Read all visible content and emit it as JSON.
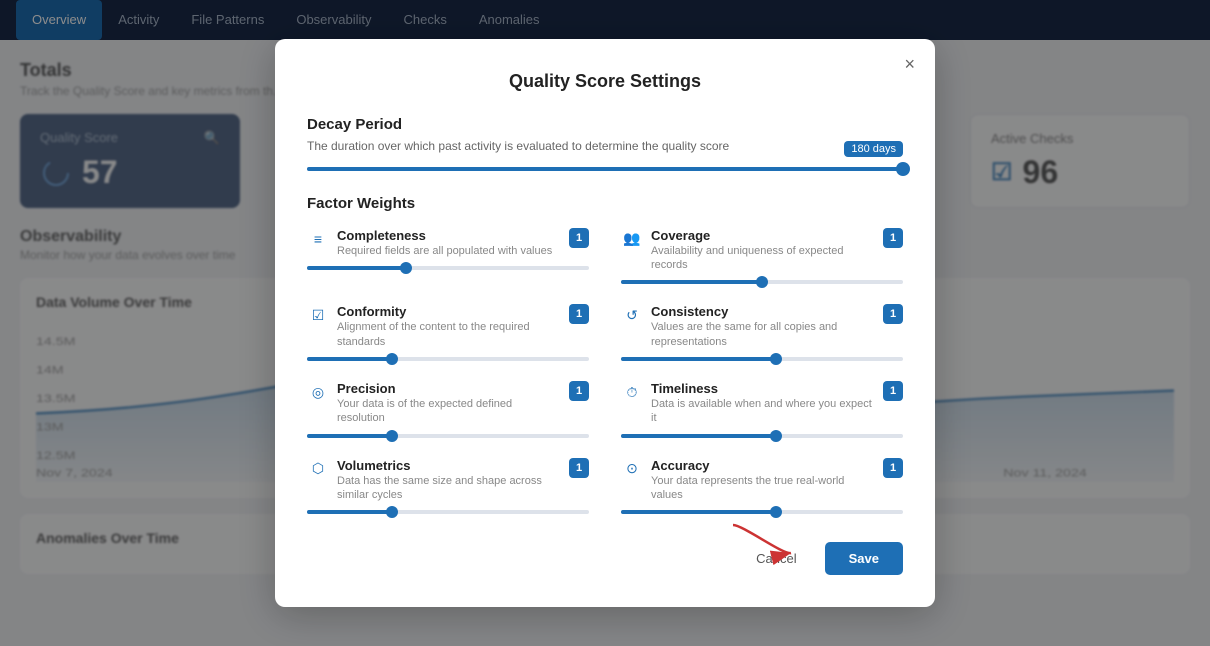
{
  "nav": {
    "tabs": [
      {
        "label": "Overview",
        "active": true
      },
      {
        "label": "Activity"
      },
      {
        "label": "File Patterns"
      },
      {
        "label": "Observability"
      },
      {
        "label": "Checks"
      },
      {
        "label": "Anomalies"
      }
    ]
  },
  "page": {
    "totals_title": "Totals",
    "totals_subtitle": "Track the Quality Score and key metrics from th...",
    "quality_score_title": "Quality Score",
    "quality_score_value": "57",
    "active_checks_title": "Active Checks",
    "active_checks_value": "96",
    "observability_title": "Observability",
    "observability_subtitle": "Monitor how your data evolves over time",
    "data_volume_title": "Data Volume Over Time",
    "anomalies_title": "Anomalies Over Time",
    "dates": {
      "start": "Nov 7, 2024",
      "end": "Nov 11, 2024"
    }
  },
  "modal": {
    "title": "Quality Score Settings",
    "close_label": "×",
    "decay_period": {
      "label": "Decay Period",
      "description": "The duration over which past activity is evaluated to determine the quality score",
      "value": 100,
      "badge": "180 days"
    },
    "factor_weights": {
      "label": "Factor Weights",
      "factors": [
        {
          "name": "Completeness",
          "description": "Required fields are all populated with values",
          "icon": "≡",
          "badge": "1",
          "value": 35,
          "col": 0
        },
        {
          "name": "Coverage",
          "description": "Availability and uniqueness of expected records",
          "icon": "👥",
          "badge": "1",
          "value": 50,
          "col": 1
        },
        {
          "name": "Conformity",
          "description": "Alignment of the content to the required standards",
          "icon": "✓",
          "badge": "1",
          "value": 30,
          "col": 0
        },
        {
          "name": "Consistency",
          "description": "Values are the same for all copies and representations",
          "icon": "↺",
          "badge": "1",
          "value": 55,
          "col": 1
        },
        {
          "name": "Precision",
          "description": "Your data is of the expected defined resolution",
          "icon": "◎",
          "badge": "1",
          "value": 30,
          "col": 0
        },
        {
          "name": "Timeliness",
          "description": "Data is available when and where you expect it",
          "icon": "⏱",
          "badge": "1",
          "value": 55,
          "col": 1
        },
        {
          "name": "Volumetrics",
          "description": "Data has the same size and shape across similar cycles",
          "icon": "⬟",
          "badge": "1",
          "value": 30,
          "col": 0
        },
        {
          "name": "Accuracy",
          "description": "Your data represents the true real-world values",
          "icon": "⊙",
          "badge": "1",
          "value": 55,
          "col": 1
        }
      ]
    },
    "cancel_label": "Cancel",
    "save_label": "Save"
  }
}
